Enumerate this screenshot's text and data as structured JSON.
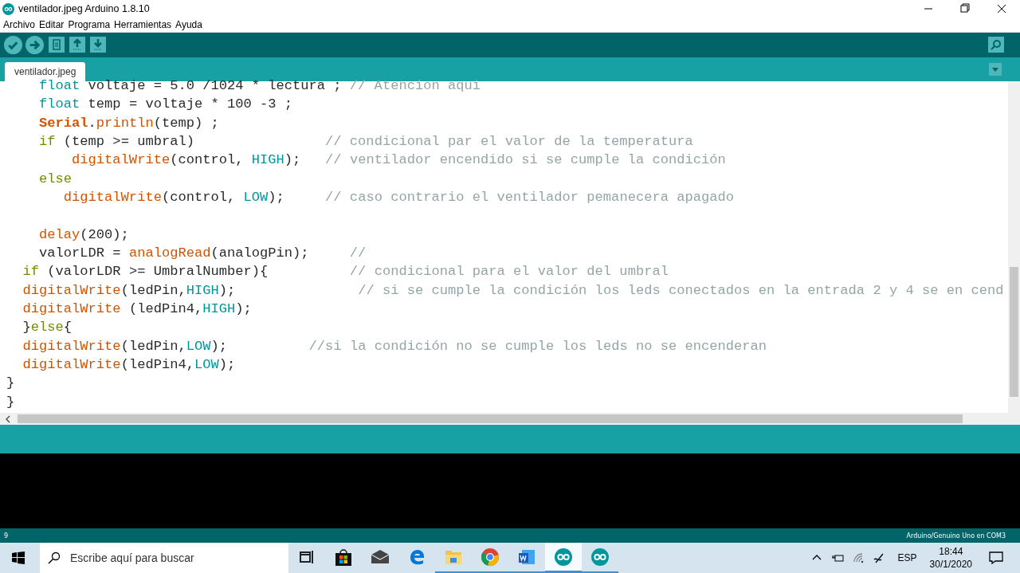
{
  "window": {
    "title": "ventilador.jpeg Arduino 1.8.10"
  },
  "menu": [
    "Archivo",
    "Editar",
    "Programa",
    "Herramientas",
    "Ayuda"
  ],
  "toolbar": [
    {
      "kind": "verify"
    },
    {
      "kind": "upload"
    },
    {
      "kind": "new"
    },
    {
      "kind": "open"
    },
    {
      "kind": "save"
    }
  ],
  "tabs": [
    {
      "label": "ventilador.jpeg",
      "selected": true
    }
  ],
  "code": [
    {
      "kind": "code",
      "tokens": [
        {
          "kind": "type",
          "text": "    float"
        },
        {
          "kind": "plain",
          "text": " voltaje = 5.0 /1024 * lectura ; "
        }
      ],
      "comment": "// Atencion aqui"
    },
    {
      "kind": "code",
      "tokens": [
        {
          "kind": "type",
          "text": "    float"
        },
        {
          "kind": "plain",
          "text": " temp = voltaje * 100 -3 ;"
        }
      ]
    },
    {
      "kind": "code",
      "tokens": [
        {
          "kind": "class",
          "text": "    Serial"
        },
        {
          "kind": "plain",
          "text": "."
        },
        {
          "kind": "function",
          "text": "println"
        },
        {
          "kind": "plain",
          "text": "(temp) ;"
        }
      ]
    },
    {
      "kind": "code",
      "tokens": [
        {
          "kind": "control",
          "text": "    if"
        },
        {
          "kind": "plain",
          "text": " (temp >= umbral)                "
        }
      ],
      "comment": "// condicional par el valor de la temperatura"
    },
    {
      "kind": "code",
      "tokens": [
        {
          "kind": "function",
          "text": "        digitalWrite"
        },
        {
          "kind": "plain",
          "text": "(control, "
        },
        {
          "kind": "constant",
          "text": "HIGH"
        },
        {
          "kind": "plain",
          "text": ");   "
        }
      ],
      "comment": "// ventilador encendido si se cumple la condición"
    },
    {
      "kind": "code",
      "tokens": [
        {
          "kind": "control",
          "text": "    else"
        }
      ]
    },
    {
      "kind": "code",
      "tokens": [
        {
          "kind": "function",
          "text": "       digitalWrite"
        },
        {
          "kind": "plain",
          "text": "(control, "
        },
        {
          "kind": "constant",
          "text": "LOW"
        },
        {
          "kind": "plain",
          "text": ");     "
        }
      ],
      "comment": "// caso contrario el ventilador pemanecera apagado"
    },
    {
      "kind": "blank"
    },
    {
      "kind": "code",
      "tokens": [
        {
          "kind": "function",
          "text": "    delay"
        },
        {
          "kind": "plain",
          "text": "(200);"
        }
      ]
    },
    {
      "kind": "code",
      "tokens": [
        {
          "kind": "plain",
          "text": "    valorLDR = "
        },
        {
          "kind": "function",
          "text": "analogRead"
        },
        {
          "kind": "plain",
          "text": "(analogPin);     "
        }
      ],
      "comment": "//"
    },
    {
      "kind": "code",
      "tokens": [
        {
          "kind": "control",
          "text": "  if"
        },
        {
          "kind": "plain",
          "text": " (valorLDR >= UmbralNumber){          "
        }
      ],
      "comment": "// condicional para el valor del umbral"
    },
    {
      "kind": "code",
      "tokens": [
        {
          "kind": "function",
          "text": "  digitalWrite"
        },
        {
          "kind": "plain",
          "text": "(ledPin,"
        },
        {
          "kind": "constant",
          "text": "HIGH"
        },
        {
          "kind": "plain",
          "text": ");               "
        }
      ],
      "comment": "// si se cumple la condición los leds conectados en la entrada 2 y 4 se en cend"
    },
    {
      "kind": "code",
      "tokens": [
        {
          "kind": "function",
          "text": "  digitalWrite"
        },
        {
          "kind": "plain",
          "text": " (ledPin4,"
        },
        {
          "kind": "constant",
          "text": "HIGH"
        },
        {
          "kind": "plain",
          "text": ");"
        }
      ]
    },
    {
      "kind": "code",
      "tokens": [
        {
          "kind": "plain",
          "text": "  }"
        },
        {
          "kind": "control",
          "text": "else"
        },
        {
          "kind": "plain",
          "text": "{"
        }
      ]
    },
    {
      "kind": "code",
      "tokens": [
        {
          "kind": "function",
          "text": "  digitalWrite"
        },
        {
          "kind": "plain",
          "text": "(ledPin,"
        },
        {
          "kind": "constant",
          "text": "LOW"
        },
        {
          "kind": "plain",
          "text": ");          "
        }
      ],
      "comment": "//si la condición no se cumple los leds no se encenderan"
    },
    {
      "kind": "code",
      "tokens": [
        {
          "kind": "function",
          "text": "  digitalWrite"
        },
        {
          "kind": "plain",
          "text": "(ledPin4,"
        },
        {
          "kind": "constant",
          "text": "LOW"
        },
        {
          "kind": "plain",
          "text": ");"
        }
      ]
    },
    {
      "kind": "code",
      "tokens": [
        {
          "kind": "plain",
          "text": "}"
        }
      ]
    },
    {
      "kind": "code",
      "tokens": [
        {
          "kind": "plain",
          "text": "}"
        }
      ]
    }
  ],
  "status_bar": {
    "line": "9",
    "board": "Arduino/Genuino Uno en COM3"
  },
  "taskbar": {
    "search": {
      "placeholder": "Escribe aquí para buscar"
    },
    "apps": [
      {
        "kind": "taskview",
        "running": false,
        "selected": false
      },
      {
        "kind": "store",
        "running": false,
        "selected": false
      },
      {
        "kind": "mail",
        "running": false,
        "selected": false
      },
      {
        "kind": "edge",
        "running": false,
        "selected": false
      },
      {
        "kind": "folder",
        "running": true,
        "selected": false
      },
      {
        "kind": "chrome",
        "running": true,
        "selected": false
      },
      {
        "kind": "word",
        "running": true,
        "selected": false
      },
      {
        "kind": "arduino",
        "running": true,
        "selected": true
      },
      {
        "kind": "arduino",
        "running": true,
        "selected": false
      }
    ],
    "language": "ESP",
    "time": "18:44",
    "date": "30/1/2020"
  }
}
